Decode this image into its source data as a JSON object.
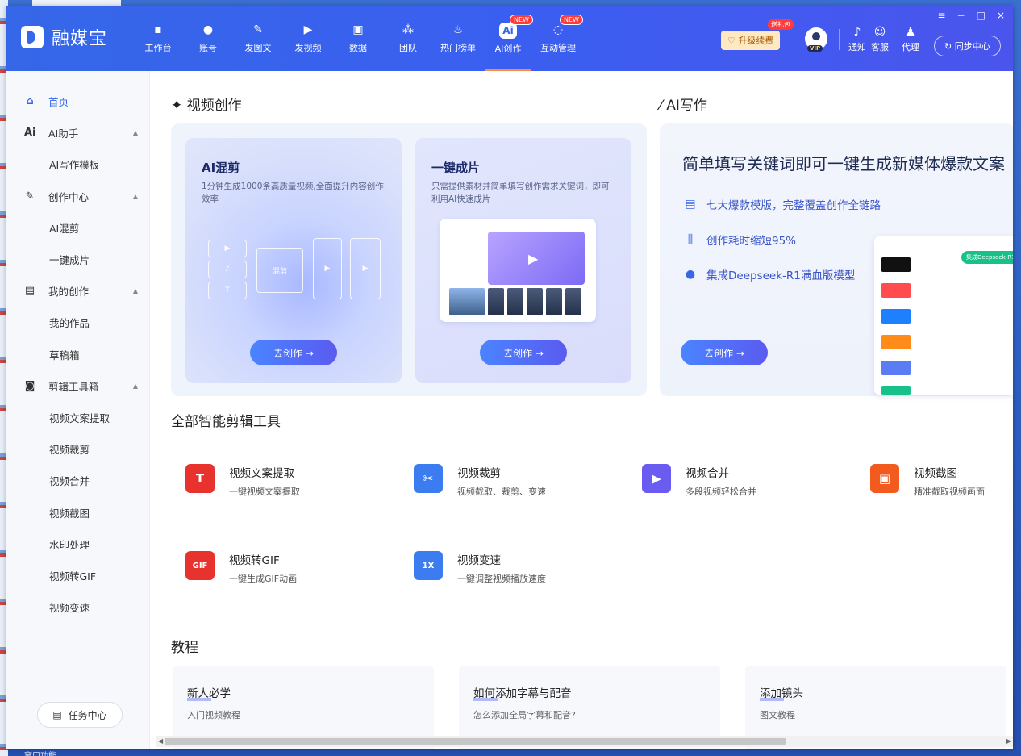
{
  "app": {
    "name": "融媒宝"
  },
  "nav": [
    {
      "label": "工作台",
      "icon": "monitor-icon",
      "glyph": "▪"
    },
    {
      "label": "账号",
      "icon": "user-icon",
      "glyph": "●"
    },
    {
      "label": "发图文",
      "icon": "pen-icon",
      "glyph": "✎"
    },
    {
      "label": "发视频",
      "icon": "play-icon",
      "glyph": "▶"
    },
    {
      "label": "数据",
      "icon": "chart-icon",
      "glyph": "▣"
    },
    {
      "label": "团队",
      "icon": "team-icon",
      "glyph": "⁂"
    },
    {
      "label": "热门榜单",
      "icon": "fire-icon",
      "glyph": "♨"
    },
    {
      "label": "AI创作",
      "icon": "ai-icon",
      "glyph": "Ai",
      "badge": "NEW",
      "active": true
    },
    {
      "label": "互动管理",
      "icon": "chat-icon",
      "glyph": "◌",
      "badge": "NEW"
    }
  ],
  "header": {
    "upgrade_label": "升级续费",
    "upgrade_badge": "送礼包",
    "vip_label": "VIP",
    "notify_label": "通知",
    "service_label": "客服",
    "agent_label": "代理",
    "sync_label": "同步中心",
    "window_controls": [
      "≡",
      "−",
      "□",
      "×"
    ]
  },
  "sidebar": {
    "items": [
      {
        "label": "首页",
        "icon": "home-icon",
        "glyph": "⌂",
        "active": true,
        "level": 0
      },
      {
        "label": "AI助手",
        "icon": "ai-assistant-icon",
        "glyph": "Ai",
        "level": 0,
        "expanded": true
      },
      {
        "label": "AI写作模板",
        "level": 1
      },
      {
        "label": "创作中心",
        "icon": "create-icon",
        "glyph": "✎",
        "level": 0,
        "expanded": true
      },
      {
        "label": "AI混剪",
        "level": 1
      },
      {
        "label": "一键成片",
        "level": 1
      },
      {
        "label": "我的创作",
        "icon": "doc-icon",
        "glyph": "▤",
        "level": 0,
        "expanded": true
      },
      {
        "label": "我的作品",
        "level": 1
      },
      {
        "label": "草稿箱",
        "level": 1
      },
      {
        "label": "剪辑工具箱",
        "icon": "toolbox-icon",
        "glyph": "◙",
        "level": 0,
        "expanded": true
      },
      {
        "label": "视频文案提取",
        "level": 1
      },
      {
        "label": "视频裁剪",
        "level": 1
      },
      {
        "label": "视频合并",
        "level": 1
      },
      {
        "label": "视频截图",
        "level": 1
      },
      {
        "label": "水印处理",
        "level": 1
      },
      {
        "label": "视频转GIF",
        "level": 1
      },
      {
        "label": "视频变速",
        "level": 1
      }
    ],
    "task_center": "任务中心"
  },
  "video_creation": {
    "title": "视频创作",
    "cards": [
      {
        "title": "AI混剪",
        "desc": "1分钟生成1000条高质量视频,全面提升内容创作效率",
        "button": "去创作 →",
        "mix_label": "混剪"
      },
      {
        "title": "一键成片",
        "desc": "只需提供素材并简单填写创作需求关键词，即可利用AI快速成片",
        "button": "去创作 →"
      }
    ]
  },
  "ai_writing": {
    "title": "AI写作",
    "headline": "简单填写关键词即可一键生成新媒体爆款文案",
    "features": [
      {
        "icon": "template-icon",
        "glyph": "▤",
        "text": "七大爆款模版，完整覆盖创作全链路"
      },
      {
        "icon": "speed-icon",
        "glyph": "⫼",
        "text": "创作耗时缩短95%"
      },
      {
        "icon": "bulb-icon",
        "glyph": "●",
        "text": "集成Deepseek-R1满血版模型"
      }
    ],
    "button": "去创作 →",
    "mock_badge": "集成Deepseek-R1"
  },
  "tools": {
    "title": "全部智能剪辑工具",
    "items": [
      {
        "name": "视频文案提取",
        "desc": "一键视频文案提取",
        "color": "#e8322e",
        "glyph": "T",
        "icon": "text-extract-icon"
      },
      {
        "name": "视频裁剪",
        "desc": "视频截取、裁剪、变速",
        "color": "#3b7cf0",
        "glyph": "✂",
        "icon": "scissors-icon"
      },
      {
        "name": "视频合并",
        "desc": "多段视频轻松合并",
        "color": "#6a5cf0",
        "glyph": "▶",
        "icon": "merge-icon"
      },
      {
        "name": "视频截图",
        "desc": "精准截取视频画面",
        "color": "#f25a1e",
        "glyph": "▣",
        "icon": "screenshot-icon"
      },
      {
        "name": "视频转GIF",
        "desc": "一键生成GIF动画",
        "color": "#e8322e",
        "glyph": "GIF",
        "icon": "gif-icon"
      },
      {
        "name": "视频变速",
        "desc": "一键调整视频播放速度",
        "color": "#3b7cf0",
        "glyph": "1X",
        "icon": "speed-change-icon"
      }
    ]
  },
  "tutorials": {
    "title": "教程",
    "items": [
      {
        "name": "新人必学",
        "desc": "入门视频教程"
      },
      {
        "name": "如何添加字幕与配音",
        "desc": "怎么添加全局字幕和配音?"
      },
      {
        "name": "添加镜头",
        "desc": "图文教程"
      }
    ]
  },
  "taskbar_text": "窗口功能"
}
